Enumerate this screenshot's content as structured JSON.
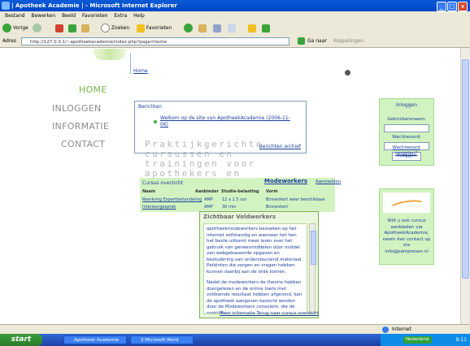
{
  "window": {
    "title": "| Apotheek Academie | - Microsoft Internet Explorer"
  },
  "menubar": {
    "items": [
      "Bestand",
      "Bewerken",
      "Beeld",
      "Favorieten",
      "Extra",
      "Help"
    ]
  },
  "toolbar": {
    "back_label": "Vorige",
    "search_label": "Zoeken",
    "favorites_label": "Favorieten"
  },
  "addressbar": {
    "label": "Adres",
    "url": "http://127.0.0.1/~apotheekacademie/index.php?page=home",
    "go_label": "Ga naar",
    "links_label": "Koppelingen"
  },
  "nav": {
    "home": "HOME",
    "login": "INLOGGEN",
    "info": "INFORMATIE",
    "contact": "CONTACT"
  },
  "breadcrumb": {
    "home_link": "Home"
  },
  "news": {
    "header": "Berichten",
    "item": "Welkom op de site van ApotheekAcademie (2006-11-06)",
    "archive_link": "Berichten archief"
  },
  "tagline": "Praktijkgerichte cursussen en trainingen voor apothekers en apotheekassistenten",
  "login_box": {
    "title": "Inloggen",
    "username_label": "Gebruikersnaam:",
    "password_label": "Wachtwoord:",
    "submit_label": "Inloggen",
    "forgot_link": "Wachtwoord vergeten?"
  },
  "promo": {
    "text": "Wilt u ook cursus aanbieden via ApotheekAcademie, neem dan contact op via info@pampresen.nl"
  },
  "courses": {
    "header": "Cursus overzicht",
    "title": "Modeworkers",
    "more_link": "Aanmelden",
    "columns": [
      "Naam",
      "Aanbieder",
      "Studie-belasting",
      "Vorm"
    ],
    "rows": [
      [
        "Roerkring Expertbehandeling",
        "AMP",
        "12 x 1.5 uur",
        "Binnenkort weer beschikbaar"
      ],
      [
        "Interieurgesprek",
        "AMP",
        "30 min",
        "Binnenkort"
      ]
    ]
  },
  "popup": {
    "title": "Zichtbaar Veldwerkers",
    "paragraphs": [
      "apotheekmodeworkers bezoeken op het internet zelfstandig en wanneer het hen het beste uitkomt meer leren over het gebruik van geneesmiddelen door middel van webgebaseerde opgaven en bestudering van ondersteunend materiaal. Patiënten die zorgen en vragen hebben kunnen daarbij aan de orde komen.",
      "Nadat de modeworkers de theorie hebben doorgelezen en de online toets met voldoende resultaat hebben afgerond, kan de apotheek aangeven bezocht worden door de Modeworkers consulent, die de praktijk..."
    ],
    "footer_link": "Meer informatie Terug naar cursus overzicht"
  },
  "statusbar": {
    "zone": "Internet"
  },
  "taskbar": {
    "start": "start",
    "tasks": [
      "Apotheek Academie",
      "3 Microsoft Word"
    ],
    "tray_app": "Nederland",
    "clock": "9:11"
  },
  "colors": {
    "accent_green": "#78b346",
    "panel_green": "#d2f3c1",
    "link_blue": "#1a3f9c",
    "xp_blue": "#0a5bd6"
  }
}
